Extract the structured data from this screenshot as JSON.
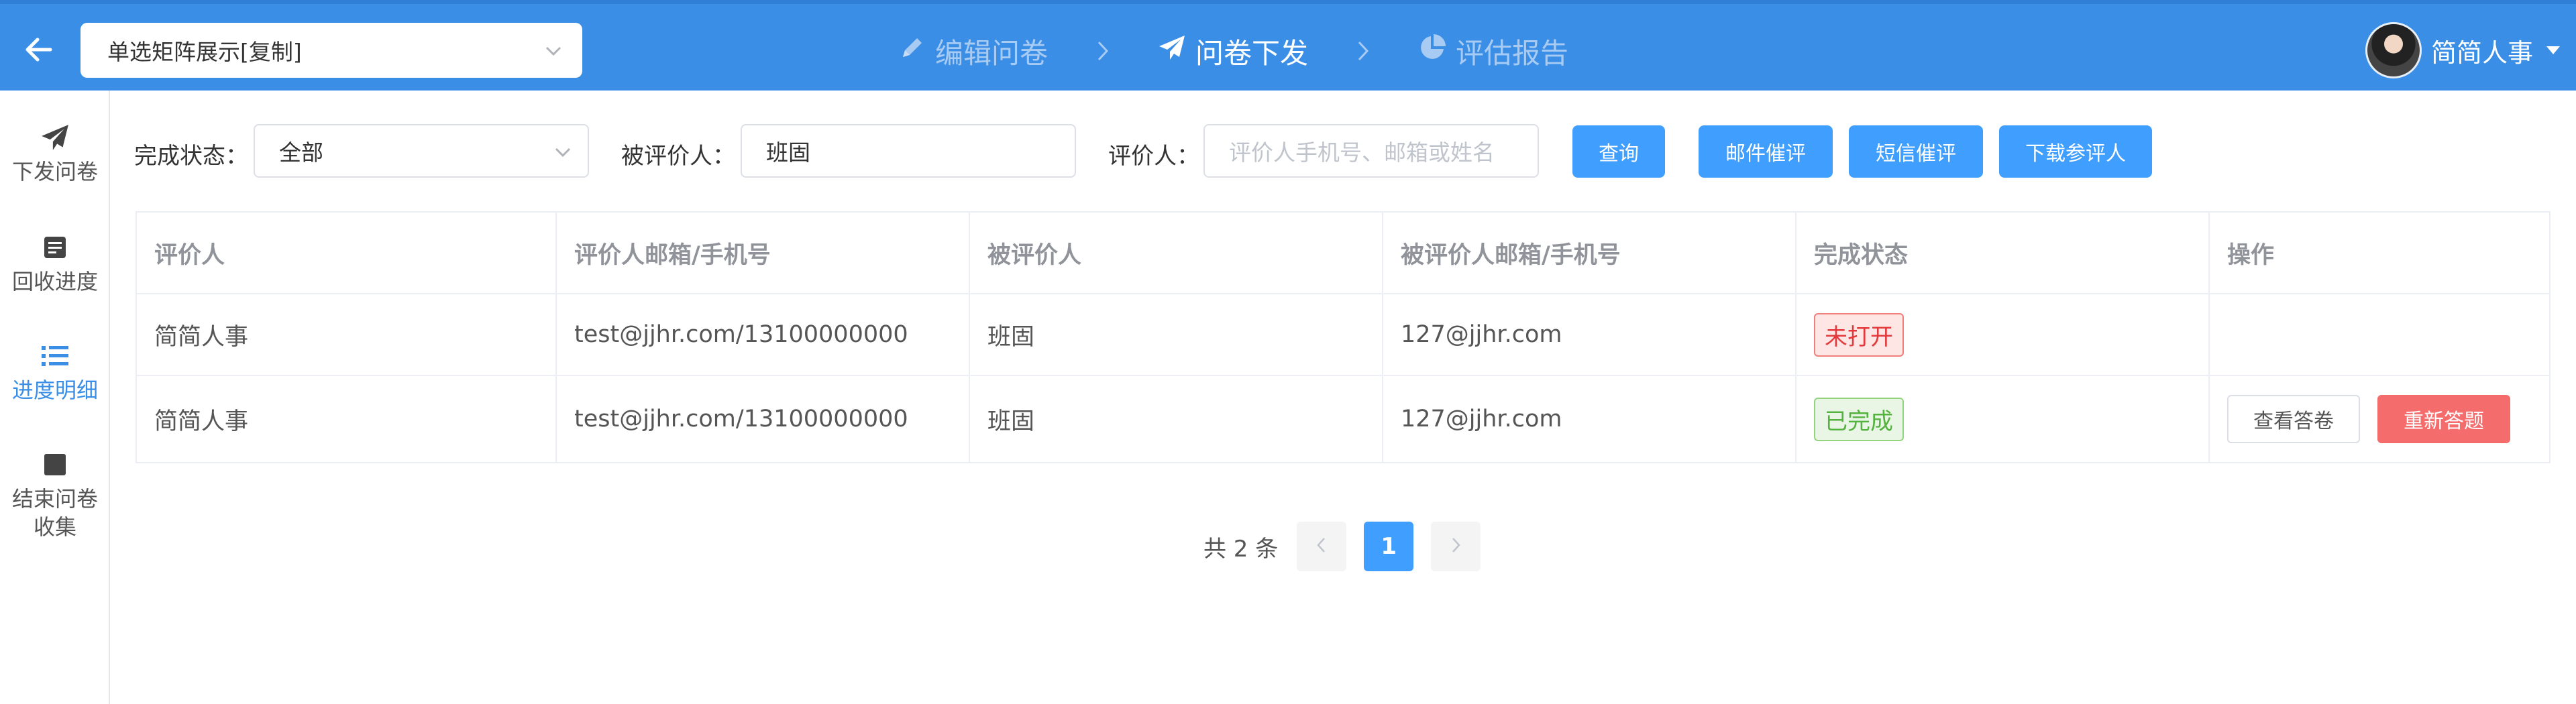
{
  "header": {
    "survey_title": "单选矩阵展示[复制]",
    "steps": [
      {
        "label": "编辑问卷",
        "active": false
      },
      {
        "label": "问卷下发",
        "active": true
      },
      {
        "label": "评估报告",
        "active": false
      }
    ],
    "user_name": "简简人事"
  },
  "sidebar": {
    "items": [
      {
        "label": "下发问卷",
        "icon": "paper-plane-icon",
        "active": false
      },
      {
        "label": "回收进度",
        "icon": "document-icon",
        "active": false
      },
      {
        "label": "进度明细",
        "icon": "list-icon",
        "active": true
      },
      {
        "label": "结束问卷\n收集",
        "icon": "stop-icon",
        "active": false
      }
    ]
  },
  "filters": {
    "status_label": "完成状态：",
    "status_value": "全部",
    "evaluatee_label": "被评价人：",
    "evaluatee_value": "班固",
    "evaluator_label": "评价人：",
    "evaluator_placeholder": "评价人手机号、邮箱或姓名",
    "query_btn": "查询",
    "email_remind_btn": "邮件催评",
    "sms_remind_btn": "短信催评",
    "download_btn": "下载参评人"
  },
  "table": {
    "columns": [
      "评价人",
      "评价人邮箱/手机号",
      "被评价人",
      "被评价人邮箱/手机号",
      "完成状态",
      "操作"
    ],
    "rows": [
      {
        "evaluator": "简简人事",
        "evaluator_contact": "test@jjhr.com/13100000000",
        "evaluatee": "班固",
        "evaluatee_contact": "127@jjhr.com",
        "status": "未打开",
        "status_color": "#e4393c"
      },
      {
        "evaluator": "简简人事",
        "evaluator_contact": "test@jjhr.com/13100000000",
        "evaluatee": "班固",
        "evaluatee_contact": "127@jjhr.com",
        "status": "已完成",
        "status_color": "#54b23f",
        "actions": [
          "查看答卷",
          "重新答题"
        ]
      }
    ]
  },
  "pagination": {
    "total_text": "共 2 条",
    "current_page": "1"
  },
  "colors": {
    "header_bg": "#3a8ee6",
    "primary": "#409eff",
    "danger": "#f56c6c"
  }
}
